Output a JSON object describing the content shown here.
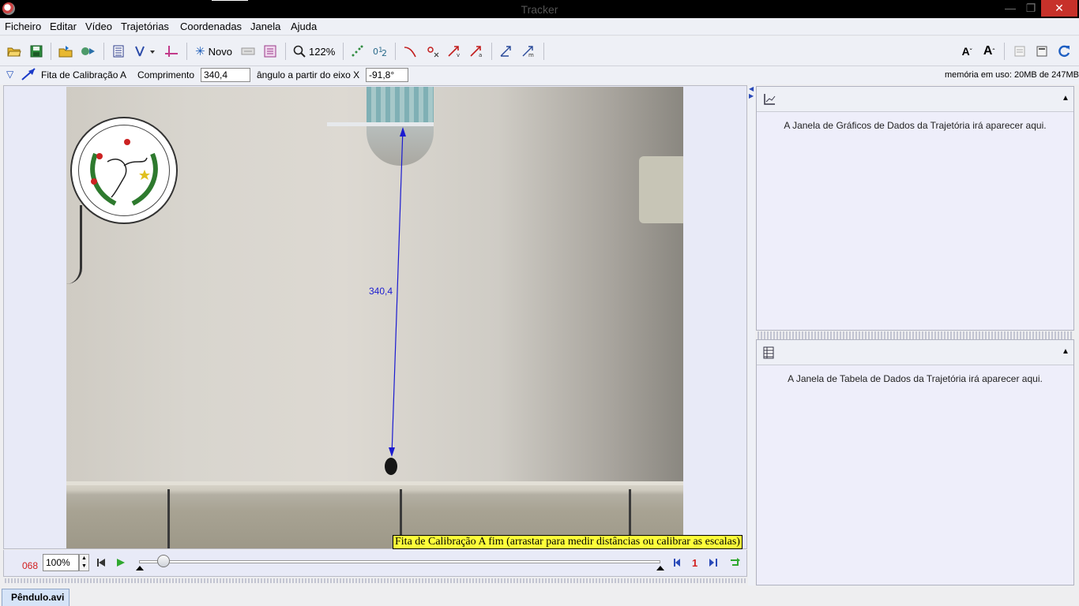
{
  "window": {
    "title": "Tracker"
  },
  "menu": [
    "Ficheiro",
    "Editar",
    "Vídeo",
    "Trajetórias",
    "Coordenadas",
    "Janela",
    "Ajuda"
  ],
  "toolbar": {
    "new_label": "Novo",
    "zoom_label": "122%"
  },
  "track": {
    "name": "Fita de Calibração A",
    "length_label": "Comprimento",
    "length_value": "340,4",
    "angle_label": "ângulo a partir do eixo X",
    "angle_value": "-91,8°"
  },
  "memory": "memória em uso: 20MB de 247MB",
  "video": {
    "measurement": "340,4",
    "tooltip": "Fita de Calibração A fim (arrastar para medir distâncias ou calibrar as escalas)"
  },
  "player": {
    "frame": "068",
    "zoom": "100%",
    "step": "1"
  },
  "plot_panel": {
    "message": "A Janela de Gráficos de Dados da Trajetória irá aparecer aqui."
  },
  "table_panel": {
    "message": "A Janela de Tabela de Dados da Trajetória irá aparecer aqui."
  },
  "tabs": [
    "Pêndulo.avi"
  ],
  "colors": {
    "accent": "#1b1bd0",
    "tooltip_bg": "#ffff3a",
    "frame_number": "#d21e1e"
  }
}
